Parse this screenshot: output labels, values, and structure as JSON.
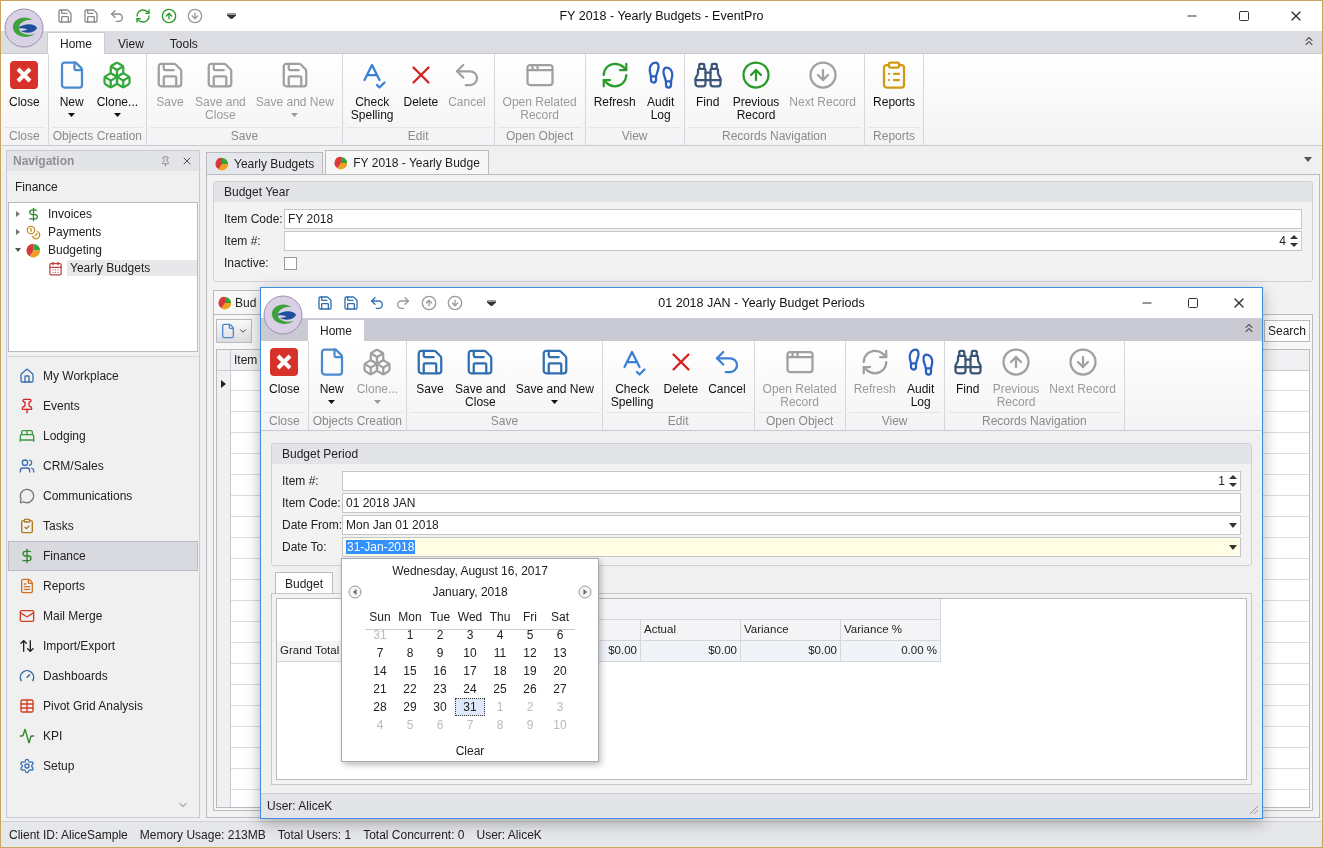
{
  "main_window": {
    "title": "FY 2018 - Yearly Budgets - EventPro"
  },
  "ribbon": {
    "tabs": [
      {
        "label": "Home",
        "selected": true
      },
      {
        "label": "View",
        "selected": false
      },
      {
        "label": "Tools",
        "selected": false
      }
    ],
    "groups": [
      {
        "label": "Close",
        "buttons": [
          {
            "label": "Close",
            "kind": "close",
            "disabled": false,
            "dropdown": false
          }
        ]
      },
      {
        "label": "Objects Creation",
        "buttons": [
          {
            "label": "New",
            "kind": "new",
            "disabled": false,
            "dropdown": true
          },
          {
            "label": "Clone...",
            "kind": "clone",
            "disabled": false,
            "dropdown": true
          }
        ]
      },
      {
        "label": "Save",
        "buttons": [
          {
            "label": "Save",
            "kind": "save",
            "disabled": true,
            "dropdown": false
          },
          {
            "label": "Save and\nClose",
            "kind": "save-close",
            "disabled": true,
            "dropdown": false
          },
          {
            "label": "Save and New",
            "kind": "save-new",
            "disabled": true,
            "dropdown": true
          }
        ]
      },
      {
        "label": "Edit",
        "buttons": [
          {
            "label": "Check\nSpelling",
            "kind": "spell",
            "disabled": false,
            "dropdown": false
          },
          {
            "label": "Delete",
            "kind": "delete",
            "disabled": false,
            "dropdown": false
          },
          {
            "label": "Cancel",
            "kind": "cancel",
            "disabled": true,
            "dropdown": false
          }
        ]
      },
      {
        "label": "Open Object",
        "buttons": [
          {
            "label": "Open Related\nRecord",
            "kind": "open-related",
            "disabled": true,
            "dropdown": false
          }
        ]
      },
      {
        "label": "View",
        "buttons": [
          {
            "label": "Refresh",
            "kind": "refresh",
            "disabled": false,
            "dropdown": false
          },
          {
            "label": "Audit\nLog",
            "kind": "audit",
            "disabled": false,
            "dropdown": false
          }
        ]
      },
      {
        "label": "Records Navigation",
        "buttons": [
          {
            "label": "Find",
            "kind": "find",
            "disabled": false,
            "dropdown": false
          },
          {
            "label": "Previous\nRecord",
            "kind": "prev",
            "disabled": false,
            "dropdown": false
          },
          {
            "label": "Next Record",
            "kind": "next",
            "disabled": true,
            "dropdown": false
          }
        ]
      },
      {
        "label": "Reports",
        "buttons": [
          {
            "label": "Reports",
            "kind": "reports",
            "disabled": false,
            "dropdown": false
          }
        ]
      }
    ]
  },
  "navigation": {
    "title": "Navigation",
    "section": "Finance",
    "tree": [
      {
        "label": "Invoices",
        "expanded": false,
        "selected": false
      },
      {
        "label": "Payments",
        "expanded": false,
        "selected": false
      },
      {
        "label": "Budgeting",
        "expanded": true,
        "selected": false,
        "children": [
          {
            "label": "Yearly Budgets",
            "selected": true
          }
        ]
      }
    ],
    "buttons": [
      {
        "label": "My Workplace",
        "selected": false
      },
      {
        "label": "Events",
        "selected": false
      },
      {
        "label": "Lodging",
        "selected": false
      },
      {
        "label": "CRM/Sales",
        "selected": false
      },
      {
        "label": "Communications",
        "selected": false
      },
      {
        "label": "Tasks",
        "selected": false
      },
      {
        "label": "Finance",
        "selected": true
      },
      {
        "label": "Reports",
        "selected": false
      },
      {
        "label": "Mail Merge",
        "selected": false
      },
      {
        "label": "Import/Export",
        "selected": false
      },
      {
        "label": "Dashboards",
        "selected": false
      },
      {
        "label": "Pivot Grid Analysis",
        "selected": false
      },
      {
        "label": "KPI",
        "selected": false
      },
      {
        "label": "Setup",
        "selected": false
      }
    ]
  },
  "document_tabs": [
    {
      "label": "Yearly Budgets",
      "selected": false
    },
    {
      "label": "FY 2018 - Yearly Budge",
      "selected": true
    }
  ],
  "budget_year": {
    "title": "Budget Year",
    "fields": [
      {
        "label": "Item Code:",
        "kind": "text",
        "value": "FY 2018"
      },
      {
        "label": "Item #:",
        "kind": "spin",
        "value": "4"
      },
      {
        "label": "Inactive:",
        "kind": "checkbox",
        "checked": false
      }
    ]
  },
  "detail": {
    "tab": "Bud",
    "grid_column": "Item",
    "search_button": "Search"
  },
  "status_bar": [
    "Client ID: AliceSample",
    "Memory Usage: 213MB",
    "Total Users: 1",
    "Total Concurrent: 0",
    "User: AliceK"
  ],
  "dialog": {
    "title": "01 2018 JAN - Yearly Budget Periods",
    "ribbon": {
      "tabs": [
        {
          "label": "Home",
          "selected": true
        }
      ],
      "groups": [
        {
          "label": "Close",
          "buttons": [
            {
              "label": "Close",
              "kind": "close",
              "disabled": false,
              "dropdown": false
            }
          ]
        },
        {
          "label": "Objects Creation",
          "buttons": [
            {
              "label": "New",
              "kind": "new",
              "disabled": false,
              "dropdown": true
            },
            {
              "label": "Clone...",
              "kind": "clone",
              "disabled": true,
              "dropdown": true
            }
          ]
        },
        {
          "label": "Save",
          "buttons": [
            {
              "label": "Save",
              "kind": "save",
              "disabled": false,
              "dropdown": false
            },
            {
              "label": "Save and\nClose",
              "kind": "save-close",
              "disabled": false,
              "dropdown": false
            },
            {
              "label": "Save and New",
              "kind": "save-new",
              "disabled": false,
              "dropdown": true
            }
          ]
        },
        {
          "label": "Edit",
          "buttons": [
            {
              "label": "Check\nSpelling",
              "kind": "spell",
              "disabled": false,
              "dropdown": false
            },
            {
              "label": "Delete",
              "kind": "delete",
              "disabled": false,
              "dropdown": false
            },
            {
              "label": "Cancel",
              "kind": "cancel",
              "disabled": false,
              "dropdown": false
            }
          ]
        },
        {
          "label": "Open Object",
          "buttons": [
            {
              "label": "Open Related\nRecord",
              "kind": "open-related",
              "disabled": true,
              "dropdown": false
            }
          ]
        },
        {
          "label": "View",
          "buttons": [
            {
              "label": "Refresh",
              "kind": "refresh",
              "disabled": true,
              "dropdown": false
            },
            {
              "label": "Audit\nLog",
              "kind": "audit",
              "disabled": false,
              "dropdown": false
            }
          ]
        },
        {
          "label": "Records Navigation",
          "buttons": [
            {
              "label": "Find",
              "kind": "find",
              "disabled": false,
              "dropdown": false
            },
            {
              "label": "Previous\nRecord",
              "kind": "prev",
              "disabled": true,
              "dropdown": false
            },
            {
              "label": "Next Record",
              "kind": "next",
              "disabled": true,
              "dropdown": false
            }
          ]
        }
      ]
    },
    "budget_period": {
      "title": "Budget Period",
      "fields": [
        {
          "label": "Item #:",
          "kind": "spin",
          "value": "1"
        },
        {
          "label": "Item Code:",
          "kind": "text",
          "value": "01 2018 JAN"
        },
        {
          "label": "Date From:",
          "kind": "date",
          "value": "Mon Jan 01 2018",
          "focused": false
        },
        {
          "label": "Date To:",
          "kind": "date",
          "value": "31-Jan-2018",
          "focused": true
        }
      ]
    },
    "tabs": [
      {
        "label": "Budget",
        "selected": true
      }
    ],
    "pivot": {
      "columns": [
        "Actual",
        "Variance",
        "Variance %"
      ],
      "row_label": "Grand Total",
      "values": [
        "$0.00",
        "$0.00",
        "$0.00",
        "0.00 %"
      ]
    },
    "calendar": {
      "today_label": "Wednesday, August 16, 2017",
      "month": "January, 2018",
      "weekdays": [
        "Sun",
        "Mon",
        "Tue",
        "Wed",
        "Thu",
        "Fri",
        "Sat"
      ],
      "days": [
        {
          "label": "31",
          "kind": "other",
          "selected": false
        },
        {
          "label": "1",
          "kind": "current",
          "selected": false
        },
        {
          "label": "2",
          "kind": "current",
          "selected": false
        },
        {
          "label": "3",
          "kind": "current",
          "selected": false
        },
        {
          "label": "4",
          "kind": "current",
          "selected": false
        },
        {
          "label": "5",
          "kind": "current",
          "selected": false
        },
        {
          "label": "6",
          "kind": "current",
          "selected": false
        },
        {
          "label": "7",
          "kind": "current",
          "selected": false
        },
        {
          "label": "8",
          "kind": "current",
          "selected": false
        },
        {
          "label": "9",
          "kind": "current",
          "selected": false
        },
        {
          "label": "10",
          "kind": "current",
          "selected": false
        },
        {
          "label": "11",
          "kind": "current",
          "selected": false
        },
        {
          "label": "12",
          "kind": "current",
          "selected": false
        },
        {
          "label": "13",
          "kind": "current",
          "selected": false
        },
        {
          "label": "14",
          "kind": "current",
          "selected": false
        },
        {
          "label": "15",
          "kind": "current",
          "selected": false
        },
        {
          "label": "16",
          "kind": "current",
          "selected": false
        },
        {
          "label": "17",
          "kind": "current",
          "selected": false
        },
        {
          "label": "18",
          "kind": "current",
          "selected": false
        },
        {
          "label": "19",
          "kind": "current",
          "selected": false
        },
        {
          "label": "20",
          "kind": "current",
          "selected": false
        },
        {
          "label": "21",
          "kind": "current",
          "selected": false
        },
        {
          "label": "22",
          "kind": "current",
          "selected": false
        },
        {
          "label": "23",
          "kind": "current",
          "selected": false
        },
        {
          "label": "24",
          "kind": "current",
          "selected": false
        },
        {
          "label": "25",
          "kind": "current",
          "selected": false
        },
        {
          "label": "26",
          "kind": "current",
          "selected": false
        },
        {
          "label": "27",
          "kind": "current",
          "selected": false
        },
        {
          "label": "28",
          "kind": "current",
          "selected": false
        },
        {
          "label": "29",
          "kind": "current",
          "selected": false
        },
        {
          "label": "30",
          "kind": "current",
          "selected": false
        },
        {
          "label": "31",
          "kind": "current",
          "selected": true
        },
        {
          "label": "1",
          "kind": "other",
          "selected": false
        },
        {
          "label": "2",
          "kind": "other",
          "selected": false
        },
        {
          "label": "3",
          "kind": "other",
          "selected": false
        },
        {
          "label": "4",
          "kind": "other",
          "selected": false
        },
        {
          "label": "5",
          "kind": "other",
          "selected": false
        },
        {
          "label": "6",
          "kind": "other",
          "selected": false
        },
        {
          "label": "7",
          "kind": "other",
          "selected": false
        },
        {
          "label": "8",
          "kind": "other",
          "selected": false
        },
        {
          "label": "9",
          "kind": "other",
          "selected": false
        },
        {
          "label": "10",
          "kind": "other",
          "selected": false
        }
      ],
      "clear": "Clear"
    },
    "status": "User: AliceK"
  }
}
